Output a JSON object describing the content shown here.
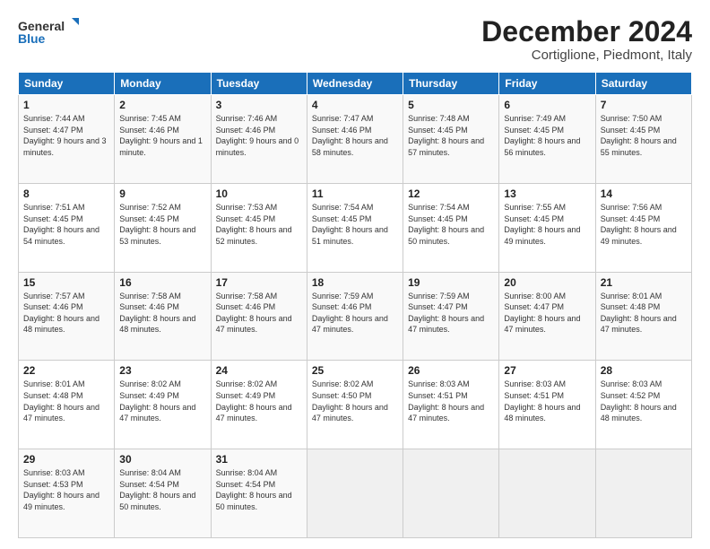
{
  "logo": {
    "line1": "General",
    "line2": "Blue",
    "icon_color": "#1a6fba"
  },
  "header": {
    "month": "December 2024",
    "location": "Cortiglione, Piedmont, Italy"
  },
  "weekdays": [
    "Sunday",
    "Monday",
    "Tuesday",
    "Wednesday",
    "Thursday",
    "Friday",
    "Saturday"
  ],
  "weeks": [
    [
      {
        "day": "1",
        "sunrise": "Sunrise: 7:44 AM",
        "sunset": "Sunset: 4:47 PM",
        "daylight": "Daylight: 9 hours and 3 minutes."
      },
      {
        "day": "2",
        "sunrise": "Sunrise: 7:45 AM",
        "sunset": "Sunset: 4:46 PM",
        "daylight": "Daylight: 9 hours and 1 minute."
      },
      {
        "day": "3",
        "sunrise": "Sunrise: 7:46 AM",
        "sunset": "Sunset: 4:46 PM",
        "daylight": "Daylight: 9 hours and 0 minutes."
      },
      {
        "day": "4",
        "sunrise": "Sunrise: 7:47 AM",
        "sunset": "Sunset: 4:46 PM",
        "daylight": "Daylight: 8 hours and 58 minutes."
      },
      {
        "day": "5",
        "sunrise": "Sunrise: 7:48 AM",
        "sunset": "Sunset: 4:45 PM",
        "daylight": "Daylight: 8 hours and 57 minutes."
      },
      {
        "day": "6",
        "sunrise": "Sunrise: 7:49 AM",
        "sunset": "Sunset: 4:45 PM",
        "daylight": "Daylight: 8 hours and 56 minutes."
      },
      {
        "day": "7",
        "sunrise": "Sunrise: 7:50 AM",
        "sunset": "Sunset: 4:45 PM",
        "daylight": "Daylight: 8 hours and 55 minutes."
      }
    ],
    [
      {
        "day": "8",
        "sunrise": "Sunrise: 7:51 AM",
        "sunset": "Sunset: 4:45 PM",
        "daylight": "Daylight: 8 hours and 54 minutes."
      },
      {
        "day": "9",
        "sunrise": "Sunrise: 7:52 AM",
        "sunset": "Sunset: 4:45 PM",
        "daylight": "Daylight: 8 hours and 53 minutes."
      },
      {
        "day": "10",
        "sunrise": "Sunrise: 7:53 AM",
        "sunset": "Sunset: 4:45 PM",
        "daylight": "Daylight: 8 hours and 52 minutes."
      },
      {
        "day": "11",
        "sunrise": "Sunrise: 7:54 AM",
        "sunset": "Sunset: 4:45 PM",
        "daylight": "Daylight: 8 hours and 51 minutes."
      },
      {
        "day": "12",
        "sunrise": "Sunrise: 7:54 AM",
        "sunset": "Sunset: 4:45 PM",
        "daylight": "Daylight: 8 hours and 50 minutes."
      },
      {
        "day": "13",
        "sunrise": "Sunrise: 7:55 AM",
        "sunset": "Sunset: 4:45 PM",
        "daylight": "Daylight: 8 hours and 49 minutes."
      },
      {
        "day": "14",
        "sunrise": "Sunrise: 7:56 AM",
        "sunset": "Sunset: 4:45 PM",
        "daylight": "Daylight: 8 hours and 49 minutes."
      }
    ],
    [
      {
        "day": "15",
        "sunrise": "Sunrise: 7:57 AM",
        "sunset": "Sunset: 4:46 PM",
        "daylight": "Daylight: 8 hours and 48 minutes."
      },
      {
        "day": "16",
        "sunrise": "Sunrise: 7:58 AM",
        "sunset": "Sunset: 4:46 PM",
        "daylight": "Daylight: 8 hours and 48 minutes."
      },
      {
        "day": "17",
        "sunrise": "Sunrise: 7:58 AM",
        "sunset": "Sunset: 4:46 PM",
        "daylight": "Daylight: 8 hours and 47 minutes."
      },
      {
        "day": "18",
        "sunrise": "Sunrise: 7:59 AM",
        "sunset": "Sunset: 4:46 PM",
        "daylight": "Daylight: 8 hours and 47 minutes."
      },
      {
        "day": "19",
        "sunrise": "Sunrise: 7:59 AM",
        "sunset": "Sunset: 4:47 PM",
        "daylight": "Daylight: 8 hours and 47 minutes."
      },
      {
        "day": "20",
        "sunrise": "Sunrise: 8:00 AM",
        "sunset": "Sunset: 4:47 PM",
        "daylight": "Daylight: 8 hours and 47 minutes."
      },
      {
        "day": "21",
        "sunrise": "Sunrise: 8:01 AM",
        "sunset": "Sunset: 4:48 PM",
        "daylight": "Daylight: 8 hours and 47 minutes."
      }
    ],
    [
      {
        "day": "22",
        "sunrise": "Sunrise: 8:01 AM",
        "sunset": "Sunset: 4:48 PM",
        "daylight": "Daylight: 8 hours and 47 minutes."
      },
      {
        "day": "23",
        "sunrise": "Sunrise: 8:02 AM",
        "sunset": "Sunset: 4:49 PM",
        "daylight": "Daylight: 8 hours and 47 minutes."
      },
      {
        "day": "24",
        "sunrise": "Sunrise: 8:02 AM",
        "sunset": "Sunset: 4:49 PM",
        "daylight": "Daylight: 8 hours and 47 minutes."
      },
      {
        "day": "25",
        "sunrise": "Sunrise: 8:02 AM",
        "sunset": "Sunset: 4:50 PM",
        "daylight": "Daylight: 8 hours and 47 minutes."
      },
      {
        "day": "26",
        "sunrise": "Sunrise: 8:03 AM",
        "sunset": "Sunset: 4:51 PM",
        "daylight": "Daylight: 8 hours and 47 minutes."
      },
      {
        "day": "27",
        "sunrise": "Sunrise: 8:03 AM",
        "sunset": "Sunset: 4:51 PM",
        "daylight": "Daylight: 8 hours and 48 minutes."
      },
      {
        "day": "28",
        "sunrise": "Sunrise: 8:03 AM",
        "sunset": "Sunset: 4:52 PM",
        "daylight": "Daylight: 8 hours and 48 minutes."
      }
    ],
    [
      {
        "day": "29",
        "sunrise": "Sunrise: 8:03 AM",
        "sunset": "Sunset: 4:53 PM",
        "daylight": "Daylight: 8 hours and 49 minutes."
      },
      {
        "day": "30",
        "sunrise": "Sunrise: 8:04 AM",
        "sunset": "Sunset: 4:54 PM",
        "daylight": "Daylight: 8 hours and 50 minutes."
      },
      {
        "day": "31",
        "sunrise": "Sunrise: 8:04 AM",
        "sunset": "Sunset: 4:54 PM",
        "daylight": "Daylight: 8 hours and 50 minutes."
      },
      null,
      null,
      null,
      null
    ]
  ]
}
